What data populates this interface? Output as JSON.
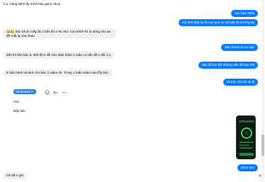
{
  "colors": {
    "outgoing": "#0a7cff",
    "incoming": "#f0f0f0",
    "highlight": "#2e7fd8"
  },
  "messages": {
    "m1": "À à. Vâng kênh ấy mình báo giá b chưa",
    "m2": "bạn báo 400k",
    "m3": "mà 400 thật sự là cao quá so với giá thị trường ấy",
    "m4": "😂😂 bác trả dc mấy đv 2 bên thì e 9x cho. Con kênh thì ta dùng cho ae đỡ mất tg của nhau",
    "m5": "250 chưởi đc ko bạn",
    "m6": "250 thì khó bác à. 300 thì e để cho. Bảo hành 1 tuần có vấn đề e đổi 1:1",
    "m7": "bác hỗ trợ đổi những vấn đề sao nhỉ",
    "m8": "E bảo hành và kick cho bác 2 video sh. Trong 1 tuần video nào lỗy bác.",
    "m9": "ok bác cho tôi xk đi",
    "phone": "0939456672",
    "m10": "Vcb",
    "m11": "Đây bác",
    "m12": "done bác",
    "m13": "Ok để e gửi"
  },
  "icons": [
    "smile-icon",
    "reply-icon",
    "more-icon"
  ]
}
